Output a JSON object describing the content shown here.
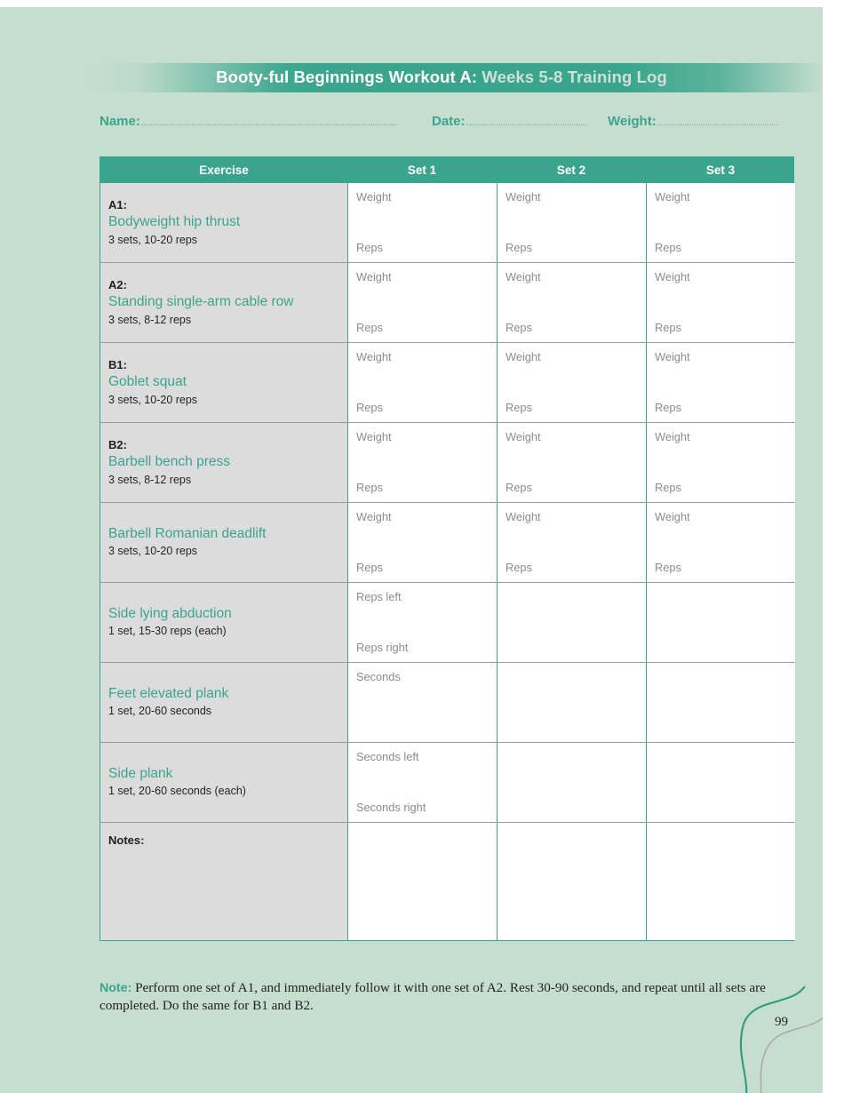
{
  "header": {
    "title_bold": "Booty-ful Beginnings",
    "title_mid": " Workout A:",
    "title_light": " Weeks 5-8 Training Log",
    "accent_color": "#3aa58c",
    "page_background": "#c6ded0"
  },
  "form_fields": {
    "name_label": "Name:",
    "date_label": "Date:",
    "weight_label": "Weight:"
  },
  "table": {
    "columns": [
      "Exercise",
      "Set 1",
      "Set 2",
      "Set 3"
    ],
    "rows": [
      {
        "code": "A1:",
        "name": "Bodyweight hip thrust",
        "meta": "3 sets, 10-20 reps",
        "slots": [
          "Weight",
          "Reps"
        ],
        "filled_sets": 3
      },
      {
        "code": "A2:",
        "name": "Standing single-arm cable row",
        "meta": "3 sets, 8-12 reps",
        "slots": [
          "Weight",
          "Reps"
        ],
        "filled_sets": 3
      },
      {
        "code": "B1:",
        "name": "Goblet squat",
        "meta": "3 sets, 10-20 reps",
        "slots": [
          "Weight",
          "Reps"
        ],
        "filled_sets": 3
      },
      {
        "code": "B2:",
        "name": "Barbell bench press",
        "meta": "3 sets, 8-12 reps",
        "slots": [
          "Weight",
          "Reps"
        ],
        "filled_sets": 3
      },
      {
        "code": "",
        "name": "Barbell Romanian deadlift",
        "meta": "3 sets, 10-20 reps",
        "slots": [
          "Weight",
          "Reps"
        ],
        "filled_sets": 3
      },
      {
        "code": "",
        "name": "Side lying abduction",
        "meta": "1 set, 15-30 reps (each)",
        "slots": [
          "Reps left",
          "Reps right"
        ],
        "filled_sets": 1
      },
      {
        "code": "",
        "name": "Feet elevated plank",
        "meta": "1 set, 20-60 seconds",
        "slots": [
          "Seconds",
          ""
        ],
        "filled_sets": 1
      },
      {
        "code": "",
        "name": "Side plank",
        "meta": "1 set, 20-60 seconds (each)",
        "slots": [
          "Seconds left",
          "Seconds right"
        ],
        "filled_sets": 1
      }
    ],
    "notes_label": "Notes:"
  },
  "footnote": {
    "label": "Note:",
    "text": " Perform one set of A1, and immediately follow it with one set of A2. Rest 30-90 seconds, and repeat until all sets are completed. Do the same for B1 and B2."
  },
  "page_number": "99"
}
